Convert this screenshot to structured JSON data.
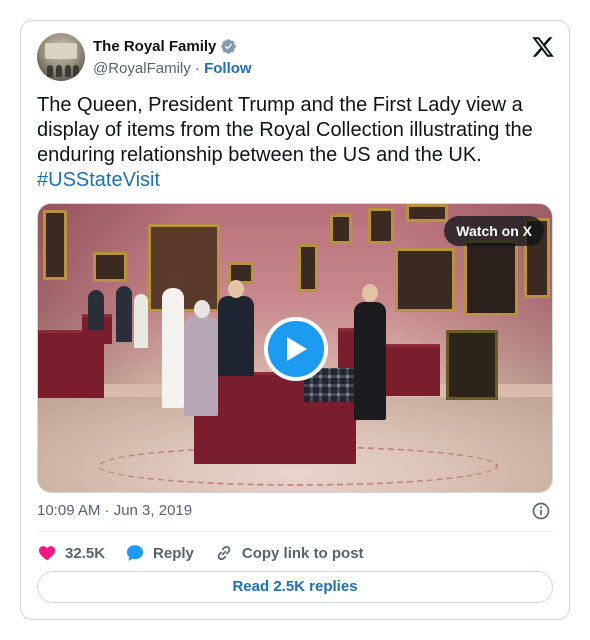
{
  "author": {
    "display_name": "The Royal Family",
    "handle": "@RoyalFamily",
    "separator": "·",
    "follow_label": "Follow",
    "verified_color": "#829aab"
  },
  "tweet": {
    "text": "The Queen, President Trump and the First Lady view a display of items from the Royal Collection illustrating the enduring relationship between the US and the UK.",
    "hashtag": "#USStateVisit"
  },
  "media": {
    "watch_label": "Watch on X",
    "play_icon": "play-icon"
  },
  "meta": {
    "timestamp": "10:09 AM · Jun 3, 2019"
  },
  "actions": {
    "like_count": "32.5K",
    "reply_label": "Reply",
    "copy_label": "Copy link to post"
  },
  "footer": {
    "read_replies_label": "Read 2.5K replies"
  },
  "colors": {
    "accent": "#1d9bf0",
    "link": "#1d6fb8",
    "like": "#f91880",
    "muted": "#536471",
    "border": "#cfd9de"
  }
}
